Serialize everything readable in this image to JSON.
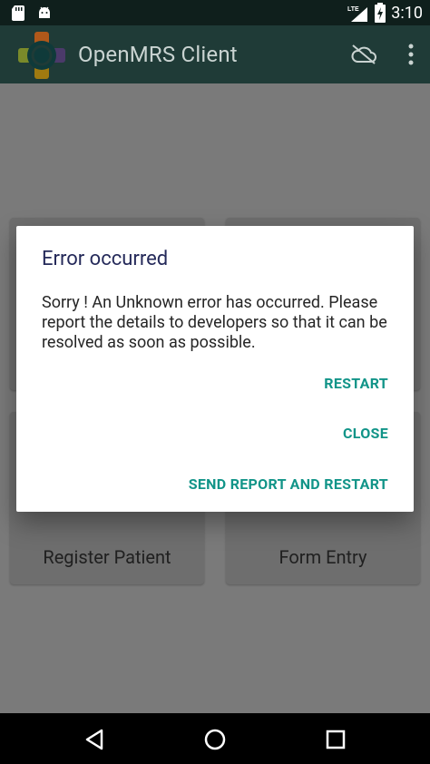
{
  "status_bar": {
    "time": "3:10",
    "network": "LTE",
    "icons": [
      "sd-card-icon",
      "android-icon",
      "signal-icon",
      "battery-icon"
    ]
  },
  "app_bar": {
    "title": "OpenMRS Client",
    "icons": [
      "app-logo-icon",
      "cloud-off-icon",
      "more-vert-icon"
    ]
  },
  "dashboard": {
    "cards": [
      {
        "label": "Register Patient"
      },
      {
        "label": "Form Entry"
      }
    ]
  },
  "dialog": {
    "title": "Error occurred",
    "message": "Sorry ! An Unknown error has occurred. Please report the details to developers so that it can be resolved as soon as possible.",
    "buttons": {
      "restart": "RESTART",
      "close": "CLOSE",
      "send_report": "SEND REPORT AND RESTART"
    },
    "accent_color": "#119488",
    "title_color": "#252a5a"
  },
  "nav_bar": {
    "icons": [
      "back-icon",
      "home-icon",
      "recents-icon"
    ]
  }
}
